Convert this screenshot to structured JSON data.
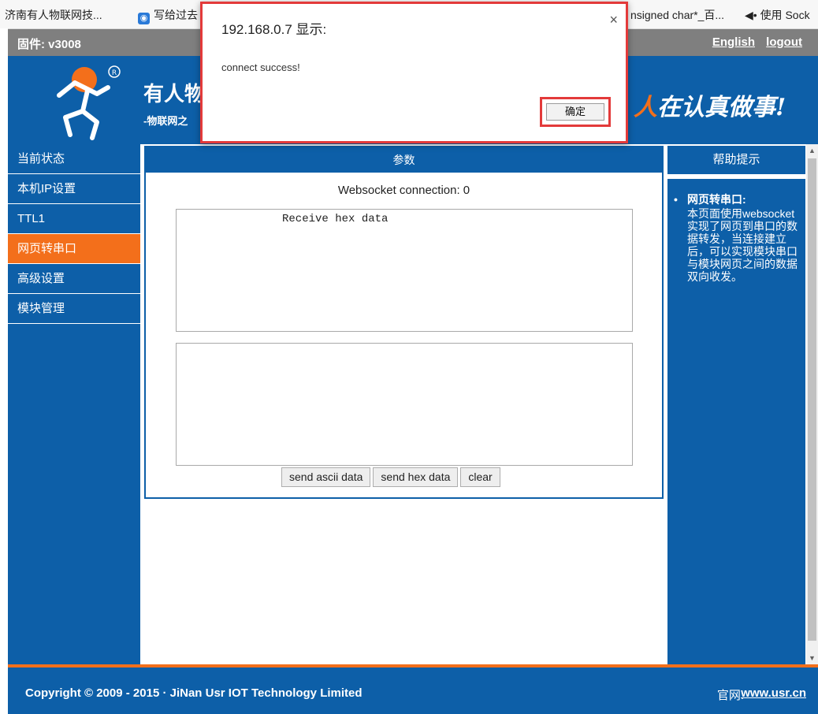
{
  "bookmarks": [
    {
      "label": "济南有人物联网技...",
      "icon": ""
    },
    {
      "label": "写给过去",
      "icon": "bookmark-icon"
    },
    {
      "label": "nsigned char*_百...",
      "icon": ""
    },
    {
      "label": "使用 Sock",
      "icon": "sound-icon"
    }
  ],
  "topbar": {
    "firmware": "固件: v3008",
    "language": "English",
    "logout": "logout"
  },
  "banner": {
    "brand": "有人物",
    "sub": "-物联网之",
    "slogan_ren": "人",
    "slogan_rest": "在认真做事!"
  },
  "sidebar": {
    "items": [
      {
        "label": "当前状态"
      },
      {
        "label": "本机IP设置"
      },
      {
        "label": "TTL1"
      },
      {
        "label": "网页转串口"
      },
      {
        "label": "高级设置"
      },
      {
        "label": "模块管理"
      }
    ]
  },
  "main": {
    "title": "参数",
    "ws_status": "Websocket connection: 0",
    "receive_text": "Receive hex data",
    "send_text": "",
    "buttons": {
      "send_ascii": "send ascii data",
      "send_hex": "send hex data",
      "clear": "clear"
    }
  },
  "help": {
    "title": "帮助提示",
    "bullet": "•",
    "heading": "网页转串口:",
    "text": "本页面使用websocket实现了网页到串口的数据转发，当连接建立后，可以实现模块串口与模块网页之间的数据双向收发。"
  },
  "footer": {
    "copyright": "Copyright © 2009 - 2015 · JiNan Usr IOT Technology Limited",
    "site_label": "官网:",
    "site_url": "www.usr.cn"
  },
  "dialog": {
    "title": "192.168.0.7 显示:",
    "message": "connect success!",
    "ok": "确定",
    "close": "×"
  },
  "colors": {
    "brand_blue": "#0d5fa8",
    "accent_orange": "#f36f1b",
    "highlight_red": "#e33a3a"
  }
}
